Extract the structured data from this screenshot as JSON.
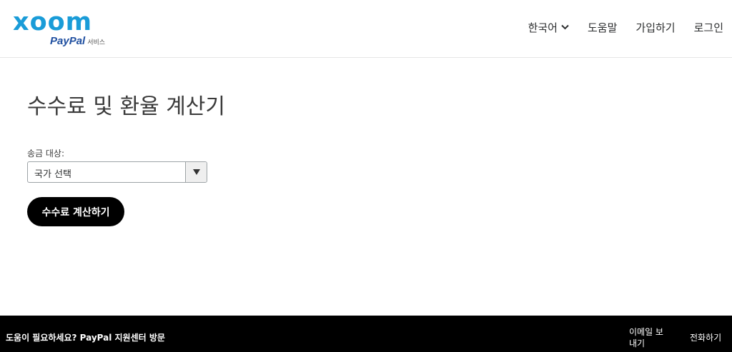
{
  "brand": {
    "logo_text": "xoom",
    "paypal_text": "PayPal",
    "service_text": "서비스",
    "logo_color": "#1a9cd8",
    "paypal_color": "#1f4fa0"
  },
  "nav": {
    "language": "한국어",
    "language_icon": "chevron-down-icon",
    "help": "도움말",
    "signup": "가입하기",
    "login": "로그인"
  },
  "main": {
    "title": "수수료 및 환율 계산기",
    "send_to_label": "송금 대상:",
    "country_select": {
      "selected": "국가 선택",
      "icon": "triangle-down-icon"
    },
    "calculate_button": "수수료 계산하기"
  },
  "footer": {
    "help_text": "도움이 필요하세요? PayPal 지원센터 방문",
    "email_link": "이메일 보내기",
    "phone_link": "전화하기"
  }
}
